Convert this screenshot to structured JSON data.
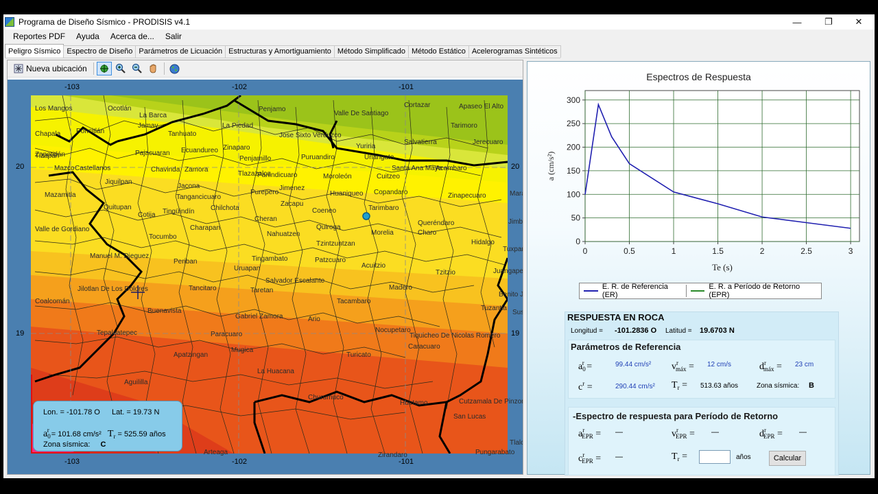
{
  "window": {
    "title": "Programa de Diseño Sísmico - PRODISIS v4.1",
    "controls": {
      "minimize": "—",
      "maximize": "❐",
      "close": "✕"
    }
  },
  "menu": [
    "Reportes PDF",
    "Ayuda",
    "Acerca de...",
    "Salir"
  ],
  "tabs": [
    "Peligro Sísmico",
    "Espectro de Diseño",
    "Parámetros de Licuación",
    "Estructuras y Amortiguamiento",
    "Método Simplificado",
    "Método Estático",
    "Acelerogramas Sintéticos"
  ],
  "toolbar": {
    "nueva_ubicacion": "Nueva ubicación"
  },
  "map": {
    "lon_labels": [
      "-103",
      "-102",
      "-101"
    ],
    "lat_labels": [
      "20",
      "19"
    ],
    "places": [
      {
        "name": "Los Mangos"
      },
      {
        "name": "Ocotlán"
      },
      {
        "name": "La Barca"
      },
      {
        "name": "Penjamo"
      },
      {
        "name": "Valle De Santiago"
      },
      {
        "name": "Cortazar"
      },
      {
        "name": "Apaseo El Alto"
      },
      {
        "name": "Jamay"
      },
      {
        "name": "Poncitlán"
      },
      {
        "name": "Tanhuato"
      },
      {
        "name": "La Piedad"
      },
      {
        "name": "Jose Sixto Verduzco"
      },
      {
        "name": "Yuriria"
      },
      {
        "name": "Salvatierra"
      },
      {
        "name": "Tarimoro"
      },
      {
        "name": "Jerecuaro"
      },
      {
        "name": "Chapala"
      },
      {
        "name": "Zinaparo"
      },
      {
        "name": "Pajacuaran"
      },
      {
        "name": "Ecuandureo"
      },
      {
        "name": "Penjamillo"
      },
      {
        "name": "Puruandiro"
      },
      {
        "name": "Uriangato"
      },
      {
        "name": "Santa Ana Maya"
      },
      {
        "name": "Acambaro"
      },
      {
        "name": "Zapotitlán"
      },
      {
        "name": "Tizapan"
      },
      {
        "name": "Mazco"
      },
      {
        "name": "Castellanos"
      },
      {
        "name": "Chavinda"
      },
      {
        "name": "Zamora"
      },
      {
        "name": "Tlazazalca"
      },
      {
        "name": "Panindicuaro"
      },
      {
        "name": "Moroleón"
      },
      {
        "name": "Cuitzeo"
      },
      {
        "name": "Jiquilpan"
      },
      {
        "name": "Jacona"
      },
      {
        "name": "Jimenez"
      },
      {
        "name": "Huaniqueo"
      },
      {
        "name": "Copandaro"
      },
      {
        "name": "Zinapecuaro"
      },
      {
        "name": "Maravatío"
      },
      {
        "name": "Mazamitla"
      },
      {
        "name": "Tangancicuaro"
      },
      {
        "name": "Purepero"
      },
      {
        "name": "Quitupan"
      },
      {
        "name": "Cotija"
      },
      {
        "name": "Chilchota"
      },
      {
        "name": "Zacapu"
      },
      {
        "name": "Tarimbaro"
      },
      {
        "name": "Tingüindín"
      },
      {
        "name": "Coeneo"
      },
      {
        "name": "Cheran"
      },
      {
        "name": "Queréndaro"
      },
      {
        "name": "Valle de Gordiano"
      },
      {
        "name": "Charapan"
      },
      {
        "name": "Quiroga"
      },
      {
        "name": "Morelia"
      },
      {
        "name": "Charo"
      },
      {
        "name": "Jimbo"
      },
      {
        "name": "Tocumbo"
      },
      {
        "name": "Nahuatzen"
      },
      {
        "name": "Tzintzuntzan"
      },
      {
        "name": "Hidalgo"
      },
      {
        "name": "Tuxpan"
      },
      {
        "name": "Manuel M. Dieguez"
      },
      {
        "name": "Tingambato"
      },
      {
        "name": "Patzcuaro"
      },
      {
        "name": "Acuitzio"
      },
      {
        "name": "Periban"
      },
      {
        "name": "Uruapan"
      },
      {
        "name": "Tzitzio"
      },
      {
        "name": "Juangapeo"
      },
      {
        "name": "Salvador Escalante"
      },
      {
        "name": "Jilotlan De Los Dolores"
      },
      {
        "name": "Tancitaro"
      },
      {
        "name": "Taretan"
      },
      {
        "name": "Madero"
      },
      {
        "name": "Benito Juarez"
      },
      {
        "name": "Coalcomán"
      },
      {
        "name": "Buenavista"
      },
      {
        "name": "Tacambaro"
      },
      {
        "name": "Tuzantla"
      },
      {
        "name": "Susupuato"
      },
      {
        "name": "Gabriel Zamora"
      },
      {
        "name": "Ario"
      },
      {
        "name": "Tepalcatepec"
      },
      {
        "name": "Paracuaro"
      },
      {
        "name": "Nocupetaro"
      },
      {
        "name": "Tiquicheo De Nicolas Romero"
      },
      {
        "name": "Mugica"
      },
      {
        "name": "Caracuaro"
      },
      {
        "name": "Apatzingan"
      },
      {
        "name": "Turicato"
      },
      {
        "name": "La Huacana"
      },
      {
        "name": "Aguililla"
      },
      {
        "name": "Churumuco"
      },
      {
        "name": "Huetamo"
      },
      {
        "name": "Cutzamala De Pinzon"
      },
      {
        "name": "San Lucas"
      },
      {
        "name": "Tlalchapa"
      },
      {
        "name": "Pungarabato"
      },
      {
        "name": "Zirandaro"
      },
      {
        "name": "Arteaga"
      }
    ],
    "info": {
      "lon": "Lon. = -101.78 O",
      "lat": "Lat. = 19.73 N",
      "a0_value": "= 101.68 cm/s²",
      "tr_value": "= 525.59 años",
      "zona_label": "Zona sísmica:",
      "zona_value": "C"
    }
  },
  "chart_data": {
    "type": "line",
    "title": "Espectros de Respuesta",
    "xlabel": "Te (s)",
    "ylabel": "a (cm/s²)",
    "xlim": [
      0,
      3.1
    ],
    "ylim": [
      0,
      320
    ],
    "xticks": [
      "0",
      "0.5",
      "1",
      "1.5",
      "2",
      "2.5",
      "3"
    ],
    "yticks": [
      "0",
      "50",
      "100",
      "150",
      "200",
      "250",
      "300"
    ],
    "grid": true,
    "legend_position": "bottom",
    "series": [
      {
        "name": "E. R. de Referencia (ER)",
        "color": "#2020b0",
        "x": [
          0,
          0.15,
          0.3,
          0.5,
          1.0,
          1.5,
          2.0,
          2.5,
          3.0
        ],
        "y": [
          99.44,
          290.44,
          222,
          165,
          105,
          80,
          52,
          40,
          28
        ]
      },
      {
        "name": "E. R. a Período de Retorno (EPR)",
        "color": "#2a8a2a",
        "x": [],
        "y": []
      }
    ]
  },
  "rock": {
    "title": "RESPUESTA EN ROCA",
    "longitud_label": "Longitud =",
    "longitud_value": "-101.2836 O",
    "latitud_label": "Latitud =",
    "latitud_value": "19.6703 N",
    "ref_title": "Parámetros de Referencia",
    "a0r_value": "99.44 cm/s²",
    "vmax_value": "12 cm/s",
    "dmax_value": "23 cm",
    "cr_value": "290.44 cm/s²",
    "tr_value": "513.63 años",
    "zona_label": "Zona sísmica:",
    "zona_value": "B",
    "epr_title": "-Espectro de respuesta para Período de Retorno",
    "aepr_value": "—",
    "vepr_value": "—",
    "depr_value": "—",
    "cepr_value": "—",
    "tr_units": "años",
    "calcular": "Calcular"
  },
  "colors": {
    "map_frame": "#4a7fb0",
    "accent_blue": "#1f3fb5",
    "info_box": "#87cbe9"
  }
}
